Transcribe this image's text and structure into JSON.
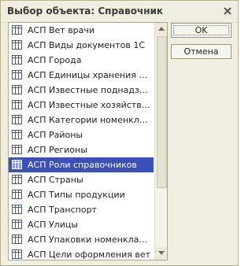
{
  "window": {
    "title": "Выбор объекта: Справочник",
    "close_icon": "close-x-icon"
  },
  "list": {
    "item_icon": "catalog-table-icon",
    "selected_index": 10,
    "items": [
      {
        "label": "АСП Вет врачи"
      },
      {
        "label": "АСП Виды документов 1С"
      },
      {
        "label": "АСП Города"
      },
      {
        "label": "АСП Единицы хранения ном..."
      },
      {
        "label": "АСП Известные поднадзорн..."
      },
      {
        "label": "АСП Известные хозяйствую..."
      },
      {
        "label": "АСП Категории номенклату..."
      },
      {
        "label": "АСП Районы"
      },
      {
        "label": "АСП Регионы"
      },
      {
        "label": "АСП Роли справочников"
      },
      {
        "label": "АСП Страны"
      },
      {
        "label": "АСП Типы продукции"
      },
      {
        "label": "АСП Транспорт"
      },
      {
        "label": "АСП Улицы"
      },
      {
        "label": "АСП Упаковки номенклатуры"
      },
      {
        "label": "АСП Цели оформления вет"
      }
    ]
  },
  "buttons": {
    "ok_label": "OK",
    "cancel_label": "Отмена"
  },
  "colors": {
    "selection": "#3b4fbd",
    "dialog_background": "#f0eee0"
  }
}
